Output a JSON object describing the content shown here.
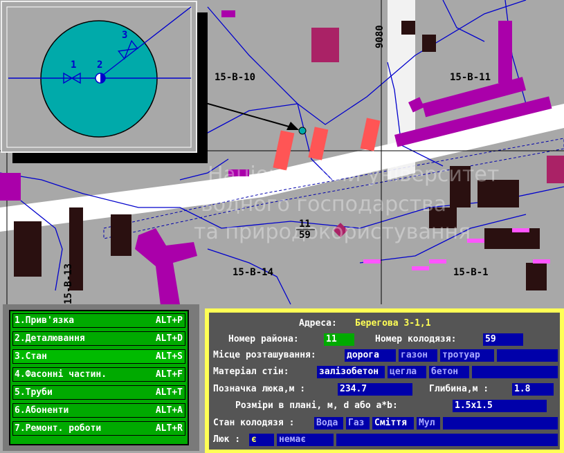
{
  "map": {
    "labels": {
      "sheet_10": "15-B-10",
      "sheet_11": "15-B-11",
      "sheet_14": "15-B-14",
      "sheet_15": "15-B-1",
      "sheet_13_vert": "15-B-13",
      "coord_top": "9080",
      "well_num": "11",
      "well_sub": "59"
    },
    "inset": {
      "n1": "1",
      "n2": "2",
      "n3": "3"
    },
    "watermark": [
      "Національний університет",
      "водного господарства",
      "та природокористування"
    ]
  },
  "menu": {
    "items": [
      {
        "label": "1.Прив'язка",
        "key": "ALT+P"
      },
      {
        "label": "2.Деталювання",
        "key": "ALT+D"
      },
      {
        "label": "3.Стан",
        "key": "ALT+S"
      },
      {
        "label": "4.Фасонні частин.",
        "key": "ALT+F"
      },
      {
        "label": "5.Труби",
        "key": "ALT+T"
      },
      {
        "label": "6.Абоненти",
        "key": "ALT+A"
      },
      {
        "label": "7.Ремонт. роботи",
        "key": "ALT+R"
      }
    ]
  },
  "panel": {
    "address_label": "Адреса:",
    "address_value": "Берегова 3-1,1",
    "district_label": "Номер района:",
    "district_value": "11",
    "well_label": "Номер колодязя:",
    "well_value": "59",
    "location_label": "Місце розташування:",
    "location_options": [
      "дорога",
      "газон",
      "тротуар"
    ],
    "material_label": "Матеріал стін:",
    "material_options": [
      "залізобетон",
      "цегла",
      "бетон"
    ],
    "hatch_label": "Позначка люка,м :",
    "hatch_value": "234.7",
    "depth_label": "Глибина,м :",
    "depth_value": "1.8",
    "size_label": "Розміри в плані, м,  d або a*b:",
    "size_value": "1.5x1.5",
    "state_label": "Стан колодязя :",
    "state_options": [
      "Вода",
      "Газ",
      "Сміття",
      "Мул"
    ],
    "hatch_exist_label": "Люк :",
    "hatch_yes": "є",
    "hatch_no": "немає"
  }
}
